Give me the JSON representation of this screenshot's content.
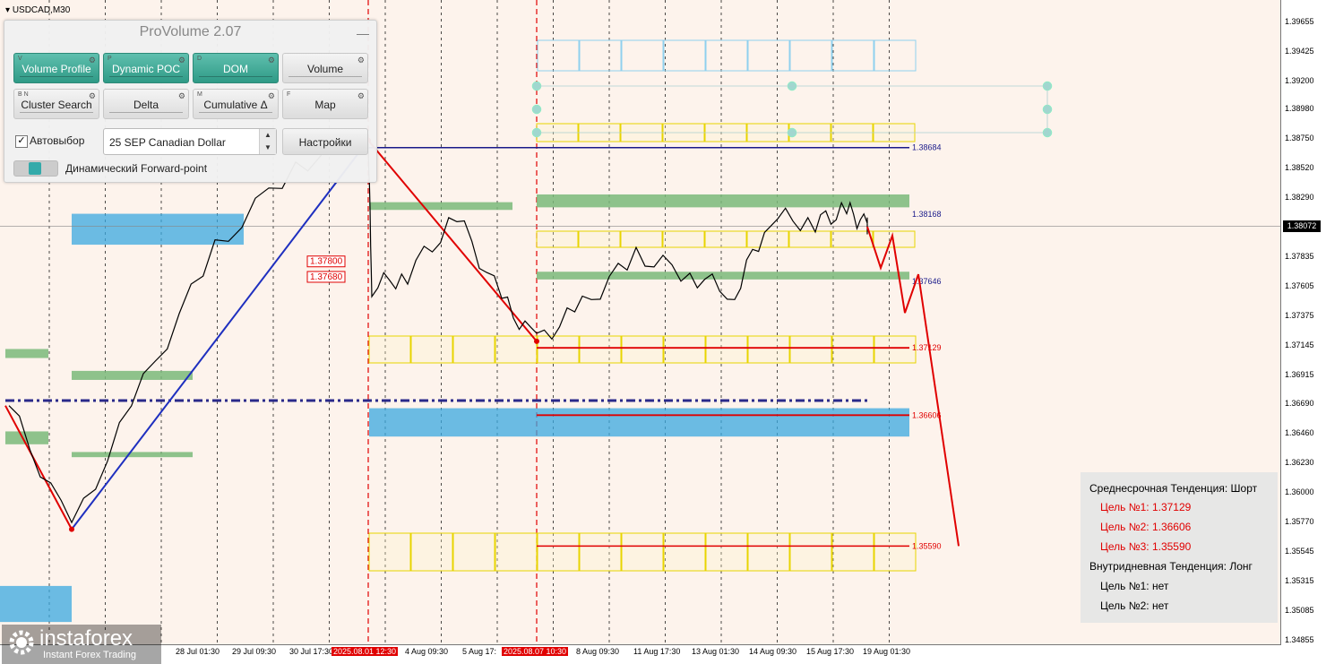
{
  "window": {
    "symbol": "USDCAD,M30"
  },
  "panel": {
    "title": "ProVolume 2.07",
    "minimize": "—",
    "buttons": [
      {
        "label": "Volume Profile",
        "key": "V",
        "active": true
      },
      {
        "label": "Dynamic POC",
        "key": "P",
        "active": true
      },
      {
        "label": "DOM",
        "key": "D",
        "active": true
      },
      {
        "label": "Volume",
        "key": "",
        "active": false
      },
      {
        "label": "Cluster Search",
        "key": "B N",
        "active": false
      },
      {
        "label": "Delta",
        "key": "",
        "active": false
      },
      {
        "label": "Cumulative Δ",
        "key": "M",
        "active": false
      },
      {
        "label": "Map",
        "key": "F",
        "active": false
      }
    ],
    "auto_label": "Автовыбор",
    "auto_checked": "✓",
    "instrument": "25 SEP Canadian Dollar",
    "settings_label": "Настройки",
    "forward_label": "Динамический Forward-point"
  },
  "chart_data": {
    "type": "line",
    "symbol": "USDCAD",
    "timeframe": "M30",
    "current_price": "1.38072",
    "ylim": [
      1.3482,
      1.3983
    ],
    "y_ticks": [
      "1.39655",
      "1.39425",
      "1.39200",
      "1.38980",
      "1.38750",
      "1.38520",
      "1.38290",
      "1.38072",
      "1.37835",
      "1.37605",
      "1.37375",
      "1.37145",
      "1.36915",
      "1.36690",
      "1.36460",
      "1.36230",
      "1.36000",
      "1.35770",
      "1.35545",
      "1.35315",
      "1.35085",
      "1.34855"
    ],
    "x_ticks": [
      {
        "label": "28 Jul 01:30",
        "highlight": false
      },
      {
        "label": "29 Jul 09:30",
        "highlight": false
      },
      {
        "label": "30 Jul 17:30",
        "highlight": false
      },
      {
        "label": "2025.08.01 12:30",
        "highlight": true
      },
      {
        "label": "4 Aug 09:30",
        "highlight": false
      },
      {
        "label": "5 Aug 17:",
        "highlight": false
      },
      {
        "label": "2025.08.07 10:30",
        "highlight": true
      },
      {
        "label": "8 Aug 09:30",
        "highlight": false
      },
      {
        "label": "11 Aug 17:30",
        "highlight": false
      },
      {
        "label": "13 Aug 01:30",
        "highlight": false
      },
      {
        "label": "14 Aug 09:30",
        "highlight": false
      },
      {
        "label": "15 Aug 17:30",
        "highlight": false
      },
      {
        "label": "19 Aug 01:30",
        "highlight": false
      }
    ],
    "level_labels": [
      {
        "text": "1.38684",
        "value": 1.38684,
        "color": "#1a1a8a"
      },
      {
        "text": "1.38168",
        "value": 1.38168,
        "color": "#1a1a8a"
      },
      {
        "text": "1.37646",
        "value": 1.37646,
        "color": "#1a1a8a"
      },
      {
        "text": "1.37129",
        "value": 1.37129,
        "color": "#e00000"
      },
      {
        "text": "1.36606",
        "value": 1.36606,
        "color": "#e00000"
      },
      {
        "text": "1.35590",
        "value": 1.3559,
        "color": "#e00000"
      }
    ],
    "box_labels": [
      {
        "text": "1.37800",
        "value": 1.378
      },
      {
        "text": "1.37680",
        "value": 1.3768
      }
    ],
    "price_path": [
      {
        "x": "27 Jul",
        "y": 1.3668
      },
      {
        "x": "28 Jul",
        "y": 1.3572
      },
      {
        "x": "29 Jul",
        "y": 1.3685
      },
      {
        "x": "30 Jul",
        "y": 1.379
      },
      {
        "x": "31 Jul",
        "y": 1.3855
      },
      {
        "x": "1 Aug",
        "y": 1.3874
      },
      {
        "x": "1 Aug",
        "y": 1.376
      },
      {
        "x": "4 Aug",
        "y": 1.377
      },
      {
        "x": "5 Aug",
        "y": 1.3815
      },
      {
        "x": "6 Aug",
        "y": 1.375
      },
      {
        "x": "7 Aug",
        "y": 1.3718
      },
      {
        "x": "8 Aug",
        "y": 1.3745
      },
      {
        "x": "11 Aug",
        "y": 1.3785
      },
      {
        "x": "12 Aug",
        "y": 1.377
      },
      {
        "x": "13 Aug",
        "y": 1.3755
      },
      {
        "x": "14 Aug",
        "y": 1.3815
      },
      {
        "x": "15 Aug",
        "y": 1.381
      },
      {
        "x": "18 Aug",
        "y": 1.382
      },
      {
        "x": "19 Aug",
        "y": 1.3807
      }
    ],
    "forecast_path": [
      1.3807,
      1.3775,
      1.38,
      1.374,
      1.377,
      1.3559
    ],
    "colors": {
      "bull_trend": "#1e2fbf",
      "bear_trend": "#e00000",
      "value_area": "#3aa8e0",
      "poc_green": "#7ab87a",
      "yellow": "#e8d400"
    }
  },
  "info": {
    "mid_title": "Среднесрочная Тенденция: Шорт",
    "mid_targets": [
      "Цель №1: 1.37129",
      "Цель №2: 1.36606",
      "Цель №3: 1.35590"
    ],
    "intra_title": "Внутридневная Тенденция: Лонг",
    "intra_targets": [
      "Цель №1: нет",
      "Цель №2: нет"
    ]
  },
  "watermark": {
    "name": "instaforex",
    "sub": "Instant Forex Trading"
  }
}
